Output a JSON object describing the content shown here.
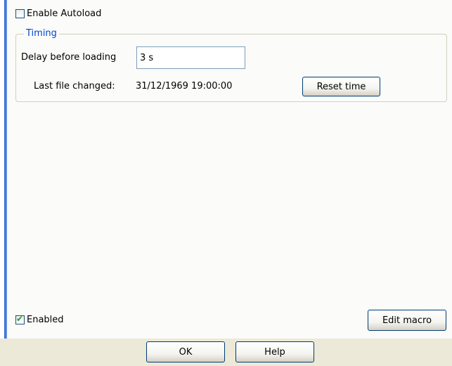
{
  "autoload": {
    "label": "Enable Autoload",
    "checked": false
  },
  "timing": {
    "title": "Timing",
    "delay_label": "Delay before loading",
    "delay_value": "3 s",
    "last_changed_label": "Last file changed:",
    "last_changed_value": "31/12/1969 19:00:00",
    "reset_button": "Reset time"
  },
  "enabled": {
    "label": "Enabled",
    "checked": true
  },
  "edit_macro_button": "Edit macro",
  "footer": {
    "ok_button": "OK",
    "help_button": "Help"
  },
  "colors": {
    "accent_bar": "#2b63c9",
    "group_title": "#0046d5",
    "footer_bg": "#ece9d8"
  }
}
